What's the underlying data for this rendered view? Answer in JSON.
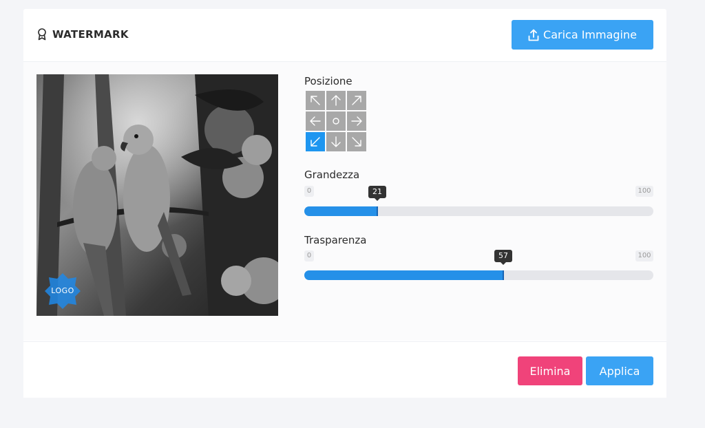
{
  "header": {
    "title": "WATERMARK",
    "title_icon": "award-icon",
    "upload_label": "Carica Immagine",
    "upload_icon": "upload-icon"
  },
  "preview": {
    "logo_text": "LOGO"
  },
  "position": {
    "label": "Posizione",
    "selected": "bottom-left",
    "cells": [
      {
        "name": "top-left",
        "icon": "arrow-up-left-icon"
      },
      {
        "name": "top-center",
        "icon": "arrow-up-icon"
      },
      {
        "name": "top-right",
        "icon": "arrow-up-right-icon"
      },
      {
        "name": "middle-left",
        "icon": "arrow-left-icon"
      },
      {
        "name": "center",
        "icon": "circle-icon"
      },
      {
        "name": "middle-right",
        "icon": "arrow-right-icon"
      },
      {
        "name": "bottom-left",
        "icon": "arrow-down-left-icon"
      },
      {
        "name": "bottom-center",
        "icon": "arrow-down-icon"
      },
      {
        "name": "bottom-right",
        "icon": "arrow-down-right-icon"
      }
    ]
  },
  "size": {
    "label": "Grandezza",
    "min": "0",
    "max": "100",
    "value": "21"
  },
  "opacity": {
    "label": "Trasparenza",
    "min": "0",
    "max": "100",
    "value": "57"
  },
  "footer": {
    "delete_label": "Elimina",
    "apply_label": "Applica"
  },
  "colors": {
    "primary": "#3aa3f4",
    "danger": "#f0437a",
    "slider_fill": "#2590e8",
    "selected_cell": "#1e96f0"
  }
}
